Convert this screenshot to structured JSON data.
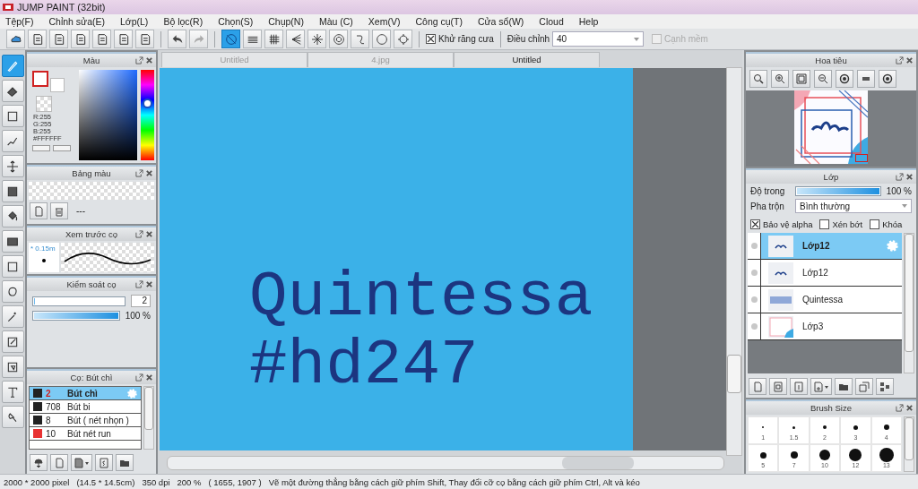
{
  "window": {
    "title": "JUMP PAINT (32bit)"
  },
  "menu": [
    "Tệp(F)",
    "Chỉnh sửa(E)",
    "Lớp(L)",
    "Bộ lọc(R)",
    "Chọn(S)",
    "Chụp(N)",
    "Màu (C)",
    "Xem(V)",
    "Công cụ(T)",
    "Cửa sổ(W)",
    "Cloud",
    "Help"
  ],
  "toolbar": {
    "snap_buttons": [
      {
        "selected": true
      },
      {
        "selected": false
      },
      {
        "selected": false
      },
      {
        "selected": false
      },
      {
        "selected": false
      },
      {
        "selected": false
      },
      {
        "selected": false
      },
      {
        "selected": false
      },
      {
        "selected": false
      }
    ],
    "antialias": {
      "label": "Khử răng cưa",
      "checked": true
    },
    "adjust": {
      "label": "Điều chỉnh",
      "value": "40"
    },
    "soft_edge": {
      "label": "Cạnh mềm",
      "checked": false,
      "disabled": true
    }
  },
  "tools": [
    {
      "selected": true
    },
    {
      "selected": false
    },
    {
      "selected": false
    },
    {
      "selected": false
    },
    {
      "selected": false
    },
    {
      "selected": false
    },
    {
      "selected": false
    },
    {
      "selected": false
    },
    {
      "selected": false
    },
    {
      "selected": false
    },
    {
      "selected": false
    },
    {
      "selected": false
    },
    {
      "selected": false
    },
    {
      "selected": false
    },
    {
      "selected": false
    }
  ],
  "color_panel": {
    "title": "Màu",
    "r": "R:255",
    "g": "G:255",
    "b": "B:255",
    "hex": "#FFFFFF"
  },
  "palette_panel": {
    "title": "Bảng màu",
    "placeholder_dash": "---"
  },
  "brush_preview": {
    "title": "Xem trước cọ",
    "size": "* 0.15m"
  },
  "brush_control": {
    "title": "Kiểm soát cọ",
    "size": {
      "level": 0.01,
      "value": "2"
    },
    "opacity": {
      "level": 1,
      "reading": "100 %"
    }
  },
  "brush_list": {
    "title": "Cọ: Bút chì",
    "items": [
      {
        "color": "#222222",
        "size": "2",
        "name": "Bút chì",
        "selected": true
      },
      {
        "color": "#222222",
        "size": "708",
        "name": "Bút bi",
        "selected": false
      },
      {
        "color": "#222222",
        "size": "8",
        "name": "Bút ( nét nhọn )",
        "selected": false
      },
      {
        "color": "#e83232",
        "size": "10",
        "name": "Bút nét run",
        "selected": false
      }
    ]
  },
  "document_tabs": [
    {
      "label": "Untitled",
      "selected": false
    },
    {
      "label": "4.jpg",
      "selected": false
    },
    {
      "label": "Untitled",
      "selected": true
    }
  ],
  "canvas_text": [
    "Quintessa",
    "#hd247"
  ],
  "navigator": {
    "title": "Hoa tiêu"
  },
  "layers_panel": {
    "title": "Lớp",
    "opacity": {
      "label": "Độ trong",
      "level": 1,
      "reading": "100 %"
    },
    "blend": {
      "label": "Pha trộn",
      "value": "Bình thường"
    },
    "options": [
      {
        "label": "Bảo vệ alpha",
        "checked": true
      },
      {
        "label": "Xén bớt",
        "checked": false
      },
      {
        "label": "Khóa",
        "checked": false
      }
    ],
    "layers": [
      {
        "name": "Lớp12",
        "selected": true
      },
      {
        "name": "Lớp12",
        "selected": false
      },
      {
        "name": "Quintessa",
        "selected": false
      },
      {
        "name": "Lớp3",
        "selected": false
      }
    ]
  },
  "brush_size_panel": {
    "title": "Brush Size",
    "sizes": [
      "1",
      "1.5",
      "2",
      "3",
      "4",
      "5",
      "7",
      "10",
      "12",
      "13"
    ]
  },
  "status_bar": [
    "2000 * 2000 pixel",
    "(14.5 * 14.5cm)",
    "350 dpi",
    "200 %",
    "( 1655, 1907 )",
    "Vẽ một đường thẳng bằng cách giữ phím Shift, Thay đổi cỡ cọ bằng cách giữ phím Ctrl, Alt và kéo"
  ]
}
